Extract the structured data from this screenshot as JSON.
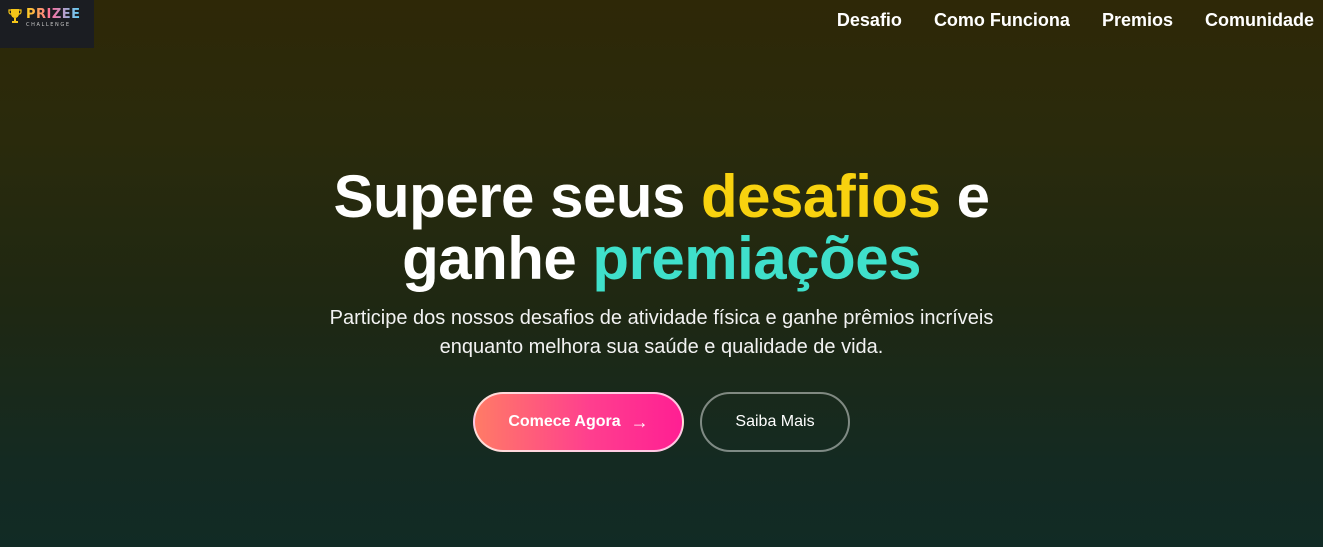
{
  "brand": {
    "logo_main": "PRIZEE",
    "logo_sub": "CHALLENGE",
    "trophy_icon": "trophy-icon",
    "colors": {
      "yellow": "#f8d20f",
      "pink": "#ff3f8e",
      "cyan": "#5ad9ff"
    }
  },
  "nav": {
    "items": [
      {
        "label": "Desafio"
      },
      {
        "label": "Como Funciona"
      },
      {
        "label": "Premios"
      },
      {
        "label": "Comunidade"
      }
    ]
  },
  "hero": {
    "title_part1": "Supere seus ",
    "title_highlight1": "desafios",
    "title_part2": " e",
    "title_part3": "ganhe ",
    "title_highlight2": "premiações",
    "subtitle_line1": "Participe dos nossos desafios de atividade física e ganhe prêmios incríveis",
    "subtitle_line2": "enquanto melhora sua saúde e qualidade de vida.",
    "accent_yellow": "#f8d20f",
    "accent_teal": "#3fe0cb"
  },
  "actions": {
    "primary_label": "Comece Agora",
    "primary_icon": "arrow-right-icon",
    "secondary_label": "Saiba Mais"
  }
}
